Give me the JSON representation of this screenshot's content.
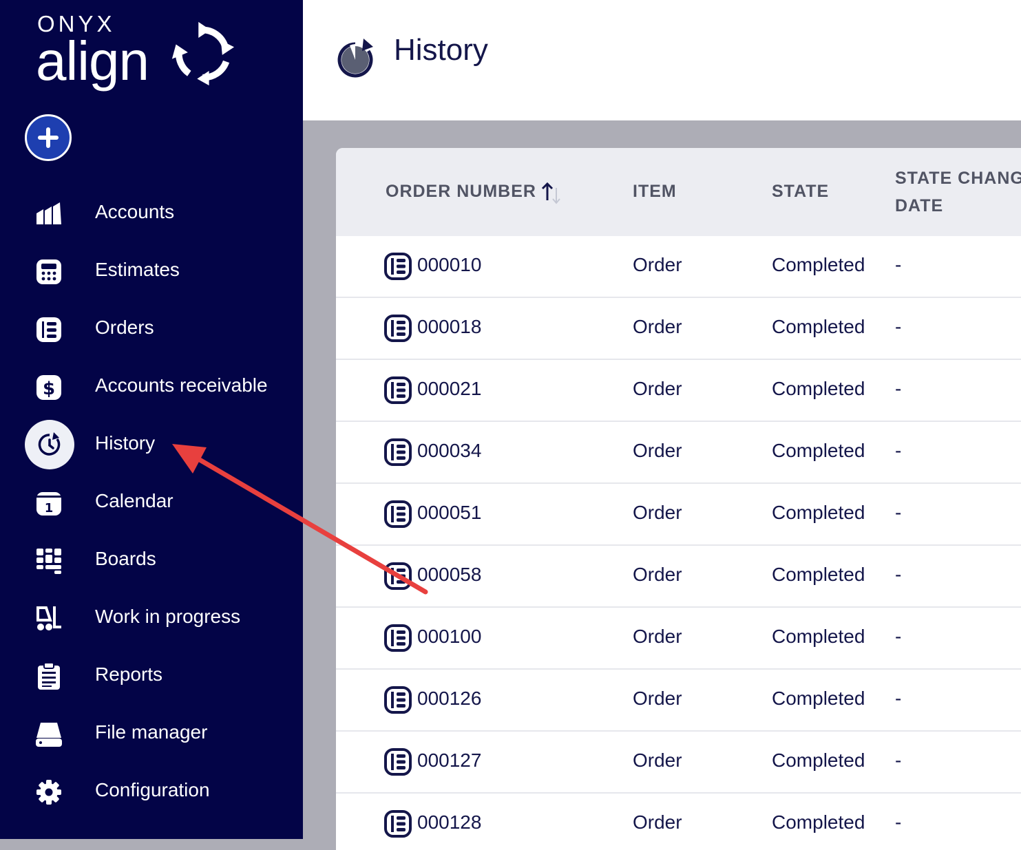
{
  "brand": {
    "top": "ONYX",
    "main": "align"
  },
  "sidebar": {
    "items": [
      {
        "label": "Accounts",
        "icon": "accounts-icon"
      },
      {
        "label": "Estimates",
        "icon": "calculator-icon"
      },
      {
        "label": "Orders",
        "icon": "orders-icon"
      },
      {
        "label": "Accounts receivable",
        "icon": "dollar-icon"
      },
      {
        "label": "History",
        "icon": "history-icon",
        "active": true
      },
      {
        "label": "Calendar",
        "icon": "calendar-icon"
      },
      {
        "label": "Boards",
        "icon": "boards-icon"
      },
      {
        "label": "Work in progress",
        "icon": "forklift-icon"
      },
      {
        "label": "Reports",
        "icon": "clipboard-icon"
      },
      {
        "label": "File manager",
        "icon": "drive-icon"
      },
      {
        "label": "Configuration",
        "icon": "gear-icon"
      }
    ]
  },
  "header": {
    "title": "History"
  },
  "table": {
    "columns": {
      "order_number": "ORDER NUMBER",
      "item": "ITEM",
      "state": "STATE",
      "state_change_line1": "STATE CHANGE",
      "state_change_line2": "DATE"
    },
    "rows": [
      {
        "number": "000010",
        "item": "Order",
        "state": "Completed",
        "date": "-"
      },
      {
        "number": "000018",
        "item": "Order",
        "state": "Completed",
        "date": "-"
      },
      {
        "number": "000021",
        "item": "Order",
        "state": "Completed",
        "date": "-"
      },
      {
        "number": "000034",
        "item": "Order",
        "state": "Completed",
        "date": "-"
      },
      {
        "number": "000051",
        "item": "Order",
        "state": "Completed",
        "date": "-"
      },
      {
        "number": "000058",
        "item": "Order",
        "state": "Completed",
        "date": "-"
      },
      {
        "number": "000100",
        "item": "Order",
        "state": "Completed",
        "date": "-"
      },
      {
        "number": "000126",
        "item": "Order",
        "state": "Completed",
        "date": "-"
      },
      {
        "number": "000127",
        "item": "Order",
        "state": "Completed",
        "date": "-"
      },
      {
        "number": "000128",
        "item": "Order",
        "state": "Completed",
        "date": "-"
      }
    ]
  },
  "colors": {
    "sidebar": "#030447",
    "accent": "#1e3fb0",
    "annotation": "#e8403e"
  }
}
